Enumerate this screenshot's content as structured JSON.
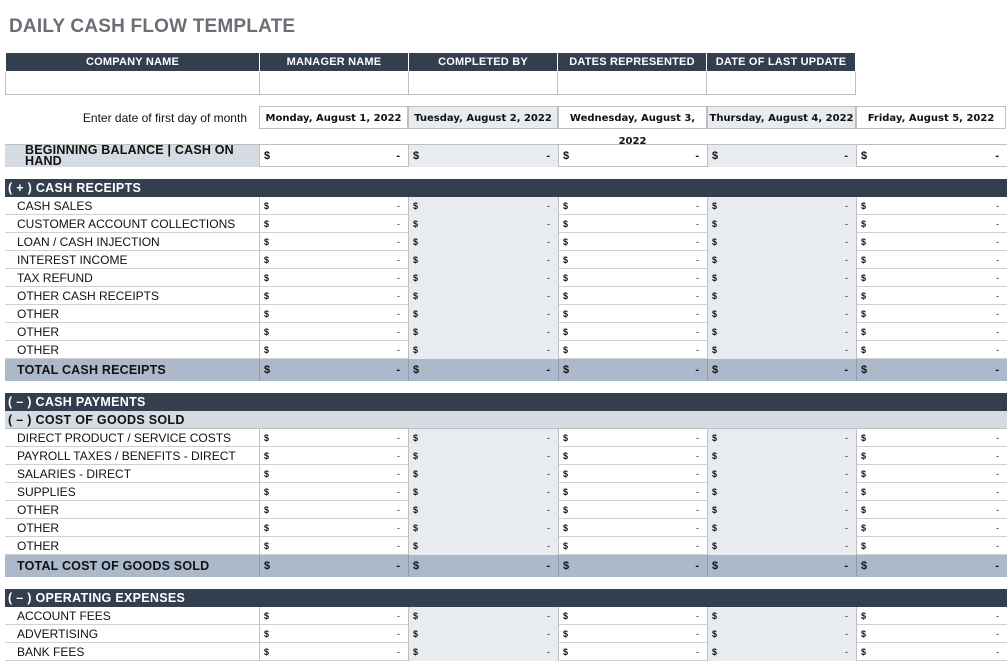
{
  "title": "DAILY CASH FLOW TEMPLATE",
  "info_headers": [
    "COMPANY NAME",
    "MANAGER NAME",
    "COMPLETED BY",
    "DATES REPRESENTED",
    "DATE OF LAST UPDATE"
  ],
  "date_prompt": "Enter date of first day of month",
  "dates": [
    "Monday, August 1, 2022",
    "Tuesday, August 2, 2022",
    "Wednesday, August 3, 2022",
    "Thursday, August 4, 2022",
    "Friday, August 5, 2022"
  ],
  "currency_symbol": "$",
  "empty_value": "-",
  "beginning_balance": {
    "label": "BEGINNING BALANCE | CASH ON HAND"
  },
  "cash_receipts": {
    "header": "( + )  CASH RECEIPTS",
    "items": [
      "CASH SALES",
      "CUSTOMER ACCOUNT COLLECTIONS",
      "LOAN / CASH INJECTION",
      "INTEREST INCOME",
      "TAX REFUND",
      "OTHER CASH RECEIPTS",
      "OTHER",
      "OTHER",
      "OTHER"
    ],
    "total_label": "TOTAL CASH RECEIPTS"
  },
  "cash_payments": {
    "header": "( – )  CASH PAYMENTS",
    "cogs_header": "( – )  COST OF GOODS SOLD",
    "cogs_items": [
      "DIRECT PRODUCT / SERVICE COSTS",
      "PAYROLL TAXES / BENEFITS - DIRECT",
      "SALARIES - DIRECT",
      "SUPPLIES",
      "OTHER",
      "OTHER",
      "OTHER"
    ],
    "cogs_total_label": "TOTAL COST OF GOODS SOLD",
    "opex_header": "( – )  OPERATING EXPENSES",
    "opex_items": [
      "ACCOUNT FEES",
      "ADVERTISING",
      "BANK FEES"
    ]
  },
  "colors": {
    "header_dark": "#333f4f",
    "total_band": "#acb9ca",
    "sub_band": "#d6dce4",
    "shade_col": "#e8ebef"
  }
}
